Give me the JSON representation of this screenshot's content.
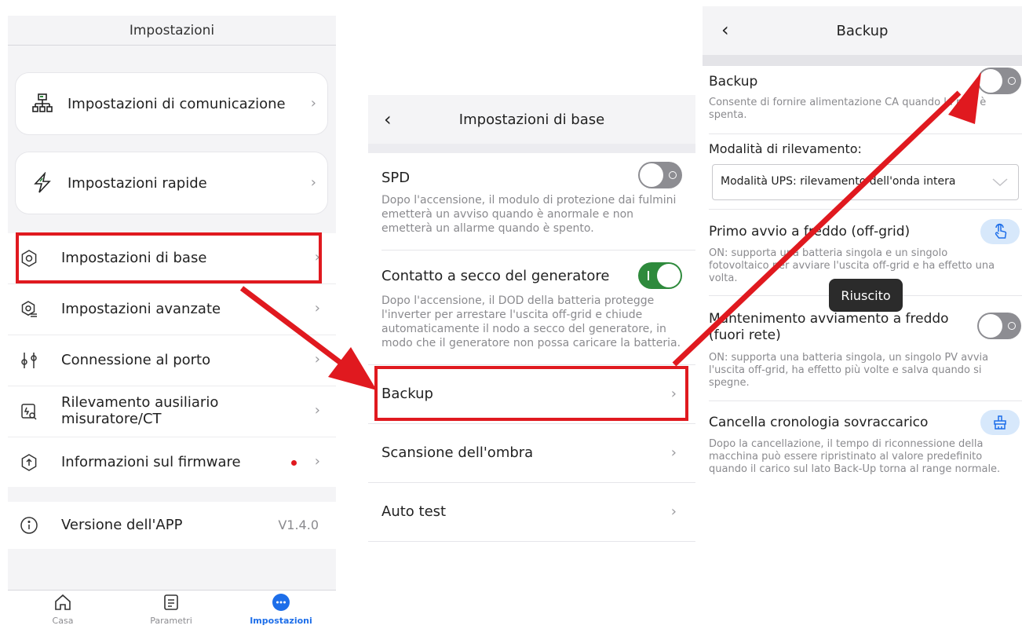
{
  "panel_settings": {
    "title": "Impostazioni",
    "cards": [
      {
        "label": "Impostazioni di comunicazione",
        "icon": "network-icon"
      },
      {
        "label": "Impostazioni rapide",
        "icon": "lightning-icon"
      }
    ],
    "items": [
      {
        "label": "Impostazioni di base",
        "icon": "gear-icon"
      },
      {
        "label": "Impostazioni avanzate",
        "icon": "advanced-gear-icon"
      },
      {
        "label": "Connessione al porto",
        "icon": "port-icon"
      },
      {
        "label": "Rilevamento ausiliario misuratore/CT",
        "icon": "meter-search-icon"
      },
      {
        "label": "Informazioni sul firmware",
        "icon": "firmware-update-icon",
        "badge_color": "#e0191f"
      }
    ],
    "version": {
      "label": "Versione dell'APP",
      "value": "V1.4.0",
      "icon": "info-icon"
    },
    "tabs": [
      {
        "label": "Casa",
        "icon": "home-icon"
      },
      {
        "label": "Parametri",
        "icon": "document-icon"
      },
      {
        "label": "Impostazioni",
        "icon": "more-icon",
        "active": true
      }
    ]
  },
  "panel_basic": {
    "title": "Impostazioni di base",
    "spd": {
      "title": "SPD",
      "desc": "Dopo l'accensione, il modulo di protezione dai fulmini emetterà un avviso quando è anormale e non emetterà un allarme quando è spento.",
      "enabled": false
    },
    "generator": {
      "title": "Contatto a secco del generatore",
      "desc": "Dopo l'accensione, il DOD della batteria protegge l'inverter per arrestare l'uscita off-grid e chiude automaticamente il nodo a secco del generatore, in modo che il generatore non possa caricare la batteria.",
      "enabled": true
    },
    "links": [
      "Backup",
      "Scansione dell'ombra",
      "Auto test"
    ]
  },
  "panel_backup": {
    "title": "Backup",
    "backup": {
      "title": "Backup",
      "desc": "Consente di fornire alimentazione CA quando la rete è spenta.",
      "enabled": false
    },
    "detection_label": "Modalità di rilevamento:",
    "detection_value": "Modalità UPS: rilevamento dell'onda intera",
    "cold_start": {
      "title": "Primo avvio a freddo (off-grid)",
      "desc": "ON: supporta una batteria singola e un singolo fotovoltaico per avviare l'uscita off-grid e ha effetto una volta."
    },
    "cold_hold": {
      "title": "Mantenimento avviamento a freddo (fuori rete)",
      "desc": "ON: supporta una batteria singola, un singolo PV avvia l'uscita off-grid, ha effetto più volte e salva quando si spegne.",
      "enabled": false
    },
    "clear_history": {
      "title": "Cancella cronologia sovraccarico",
      "desc": "Dopo la cancellazione, il tempo di riconnessione della macchina può essere ripristinato al valore predefinito quando il carico sul lato Back-Up torna al range normale."
    },
    "toast": "Riuscito"
  },
  "colors": {
    "highlight": "#e0191f",
    "toggle_on": "#2e8a3c",
    "toggle_off": "#8d8d92",
    "accent_blue": "#1d6ee9"
  }
}
